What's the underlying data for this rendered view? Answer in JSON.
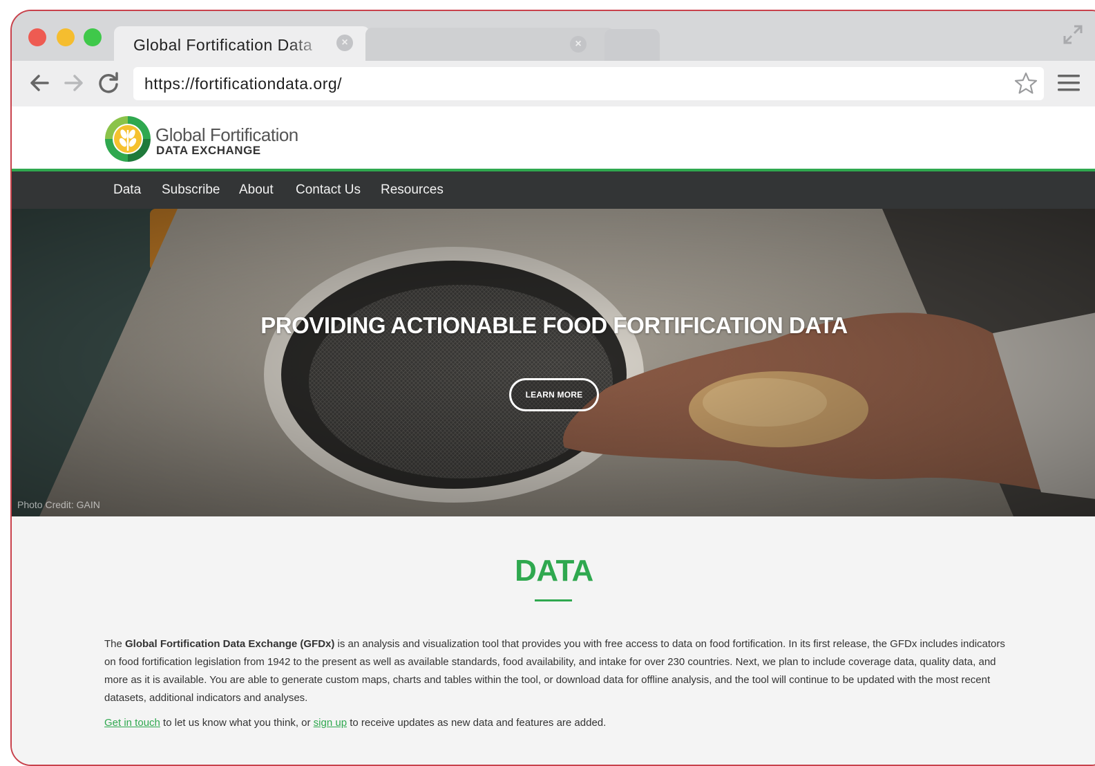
{
  "browser": {
    "tab_title": "Global Fortification Data",
    "url": "https://fortificationdata.org/"
  },
  "site": {
    "logo_line1": "Global Fortification",
    "logo_line2": "DATA EXCHANGE",
    "nav": [
      "Data",
      "Subscribe",
      "About",
      "Contact Us",
      "Resources"
    ]
  },
  "hero": {
    "title": "PROVIDING ACTIONABLE FOOD FORTIFICATION DATA",
    "button": "LEARN MORE",
    "photo_credit": "Photo Credit: GAIN"
  },
  "content": {
    "heading": "DATA",
    "intro_prefix": "The ",
    "intro_bold": "Global Fortification Data Exchange (GFDx)",
    "intro_rest": " is an analysis and visualization tool that provides you with free access to data on food fortification. In its first release, the GFDx includes indicators on food fortification legislation from 1942 to the present as well as available standards, food availability, and intake for over 230 countries. Next, we plan to include coverage data, quality data, and more as it is available. You are able to generate custom maps, charts and tables within the tool, or download data for offline analysis, and the tool will continue to be updated with the most recent datasets, additional indicators and analyses.",
    "link1": "Get in touch",
    "mid_text": " to let us know what you think, or ",
    "link2": "sign up",
    "end_text": " to receive updates as new data and features are added."
  },
  "colors": {
    "brand_green": "#2fa84f",
    "nav_bg": "#333536"
  }
}
